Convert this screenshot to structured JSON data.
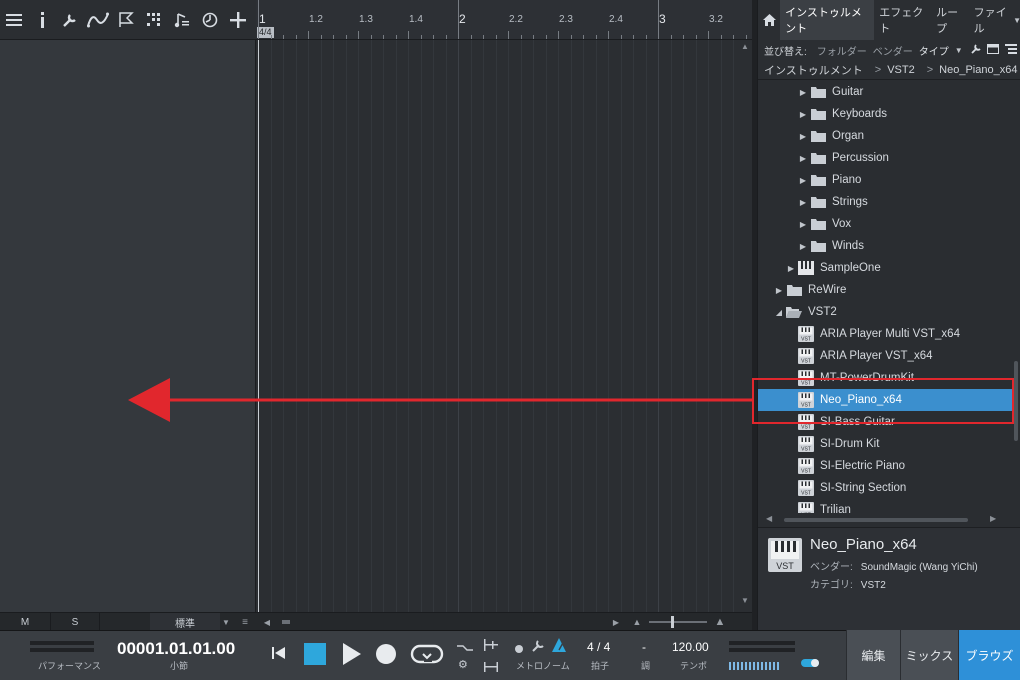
{
  "toolbar": {
    "icons": [
      "list-icon",
      "info-icon",
      "wrench-icon",
      "automation-curve-icon",
      "flag-icon",
      "grid-icon",
      "music-note-icon",
      "clock-icon",
      "add-icon"
    ]
  },
  "ruler": {
    "labels": [
      "1",
      "1.2",
      "1.3",
      "1.4",
      "2",
      "2.2",
      "2.3",
      "2.4",
      "3",
      "3.2"
    ],
    "time_signature": "4/4"
  },
  "arrange_bottom": {
    "mute_label": "M",
    "solo_label": "S",
    "mode_label": "標準"
  },
  "browser": {
    "tabs": [
      "インストゥルメント",
      "エフェクト",
      "ループ",
      "ファイル"
    ],
    "sort": {
      "label": "並び替え:",
      "options": [
        "フォルダー",
        "ベンダー",
        "タイプ"
      ]
    },
    "breadcrumb": [
      "インストゥルメント",
      "VST2",
      "Neo_Piano_x64"
    ],
    "tree": [
      {
        "label": "Guitar",
        "type": "folder",
        "indent": 3,
        "expander": "closed"
      },
      {
        "label": "Keyboards",
        "type": "folder",
        "indent": 3,
        "expander": "closed"
      },
      {
        "label": "Organ",
        "type": "folder",
        "indent": 3,
        "expander": "closed"
      },
      {
        "label": "Percussion",
        "type": "folder",
        "indent": 3,
        "expander": "closed"
      },
      {
        "label": "Piano",
        "type": "folder",
        "indent": 3,
        "expander": "closed"
      },
      {
        "label": "Strings",
        "type": "folder",
        "indent": 3,
        "expander": "closed"
      },
      {
        "label": "Vox",
        "type": "folder",
        "indent": 3,
        "expander": "closed"
      },
      {
        "label": "Winds",
        "type": "folder",
        "indent": 3,
        "expander": "closed"
      },
      {
        "label": "SampleOne",
        "type": "keys",
        "indent": 2,
        "expander": "closed"
      },
      {
        "label": "ReWire",
        "type": "folder",
        "indent": 1,
        "expander": "closed"
      },
      {
        "label": "VST2",
        "type": "folder-open",
        "indent": 1,
        "expander": "open"
      },
      {
        "label": "ARIA Player Multi VST_x64",
        "type": "vst",
        "indent": 2,
        "expander": "none"
      },
      {
        "label": "ARIA Player VST_x64",
        "type": "vst",
        "indent": 2,
        "expander": "none"
      },
      {
        "label": "MT-PowerDrumKit",
        "type": "vst",
        "indent": 2,
        "expander": "none"
      },
      {
        "label": "Neo_Piano_x64",
        "type": "vst",
        "indent": 2,
        "expander": "none",
        "selected": true
      },
      {
        "label": "SI-Bass Guitar",
        "type": "vst",
        "indent": 2,
        "expander": "none"
      },
      {
        "label": "SI-Drum Kit",
        "type": "vst",
        "indent": 2,
        "expander": "none"
      },
      {
        "label": "SI-Electric Piano",
        "type": "vst",
        "indent": 2,
        "expander": "none"
      },
      {
        "label": "SI-String Section",
        "type": "vst",
        "indent": 2,
        "expander": "none"
      },
      {
        "label": "Trilian",
        "type": "vst",
        "indent": 2,
        "expander": "none"
      }
    ],
    "info": {
      "name": "Neo_Piano_x64",
      "vendor_label": "ベンダー:",
      "vendor_value": "SoundMagic (Wang YiChi)",
      "category_label": "カテゴリ:",
      "category_value": "VST2",
      "icon_text": "VST"
    }
  },
  "transport": {
    "performance_label": "パフォーマンス",
    "position": "00001.01.01.00",
    "position_label": "小節",
    "metronome_label": "メトロノーム",
    "time_sig_value": "4 / 4",
    "time_sig_label": "拍子",
    "key_value": "-",
    "key_label": "調",
    "tempo_value": "120.00",
    "tempo_label": "テンポ"
  },
  "views": {
    "edit": "編集",
    "mix": "ミックス",
    "browse": "ブラウズ"
  },
  "colors": {
    "accent": "#2e90d8",
    "selection": "#3b8fce",
    "highlight": "#e1272d"
  }
}
